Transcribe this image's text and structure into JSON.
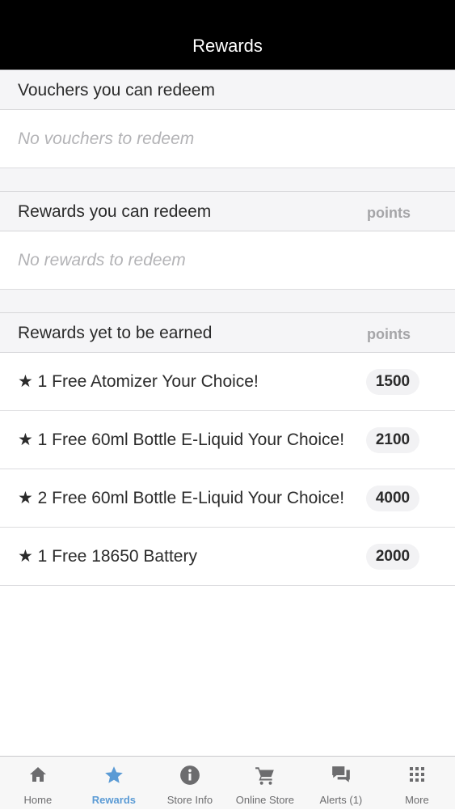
{
  "header": {
    "title": "Rewards"
  },
  "vouchers": {
    "title": "Vouchers you can redeem",
    "empty_text": "No vouchers to redeem"
  },
  "redeemable": {
    "title": "Rewards you can redeem",
    "points_label": "points",
    "empty_text": "No rewards to redeem"
  },
  "unearned": {
    "title": "Rewards yet to be earned",
    "points_label": "points",
    "items": [
      {
        "label": "★ 1 Free Atomizer Your Choice!",
        "points": "1500"
      },
      {
        "label": "★ 1 Free 60ml Bottle E-Liquid Your Choice!",
        "points": "2100"
      },
      {
        "label": "★ 2 Free 60ml Bottle E-Liquid Your Choice!",
        "points": "4000"
      },
      {
        "label": "★ 1 Free 18650 Battery",
        "points": "2000"
      }
    ]
  },
  "tabbar": {
    "active_color": "#5b9bd5",
    "inactive_color": "#6c6c6e",
    "tabs": [
      {
        "label": "Home",
        "icon": "home-icon"
      },
      {
        "label": "Rewards",
        "icon": "star-icon"
      },
      {
        "label": "Store Info",
        "icon": "info-icon"
      },
      {
        "label": "Online Store",
        "icon": "cart-icon"
      },
      {
        "label": "Alerts (1)",
        "icon": "chat-bubbles-icon"
      },
      {
        "label": "More",
        "icon": "grid-dots-icon"
      }
    ]
  }
}
